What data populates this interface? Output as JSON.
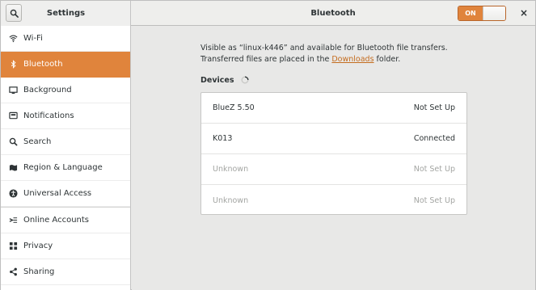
{
  "header": {
    "app_title": "Settings",
    "panel_title": "Bluetooth",
    "switch_label": "ON",
    "close_glyph": "×",
    "accent_color": "#e0843c"
  },
  "sidebar": {
    "items": [
      {
        "label": "Wi-Fi",
        "icon": "wifi-icon"
      },
      {
        "label": "Bluetooth",
        "icon": "bluetooth-icon",
        "active": true
      },
      {
        "label": "Background",
        "icon": "background-icon"
      },
      {
        "label": "Notifications",
        "icon": "notifications-icon"
      },
      {
        "label": "Search",
        "icon": "search-icon"
      },
      {
        "label": "Region & Language",
        "icon": "region-icon"
      },
      {
        "label": "Universal Access",
        "icon": "universal-access-icon"
      },
      {
        "label": "Online Accounts",
        "icon": "online-accounts-icon"
      },
      {
        "label": "Privacy",
        "icon": "privacy-icon"
      },
      {
        "label": "Sharing",
        "icon": "sharing-icon"
      }
    ]
  },
  "content": {
    "desc_part1": "Visible as “linux-k446” and available for Bluetooth file transfers. Transferred files are placed in the ",
    "desc_link": "Downloads",
    "desc_part2": " folder.",
    "devices_label": "Devices",
    "devices": [
      {
        "name": "BlueZ 5.50",
        "status": "Not Set Up",
        "dim": false
      },
      {
        "name": "K013",
        "status": "Connected",
        "dim": false
      },
      {
        "name": "Unknown",
        "status": "Not Set Up",
        "dim": true
      },
      {
        "name": "Unknown",
        "status": "Not Set Up",
        "dim": true
      }
    ]
  }
}
